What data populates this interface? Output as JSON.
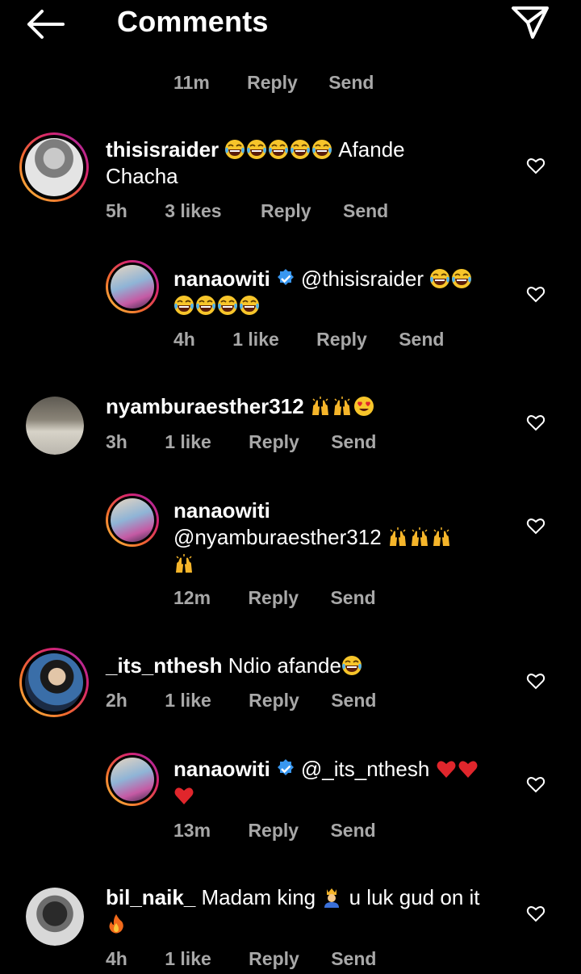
{
  "header": {
    "title": "Comments"
  },
  "top_meta": {
    "time": "11m",
    "reply": "Reply",
    "send": "Send"
  },
  "comments": [
    {
      "user": "thisisraider",
      "text_after": "Afande",
      "text_line2": "Chacha",
      "time": "5h",
      "likes": "3 likes",
      "reply": "Reply",
      "send": "Send",
      "emoji": [
        "laugh-cry",
        "laugh-cry",
        "laugh-cry",
        "laugh-cry",
        "laugh-cry"
      ]
    },
    {
      "user": "nanaowiti",
      "verified": true,
      "mention": "@thisisraider",
      "time": "4h",
      "likes": "1 like",
      "reply": "Reply",
      "send": "Send",
      "emoji": [
        "laugh-cry",
        "laugh-cry",
        "laugh-cry",
        "laugh-cry",
        "laugh-cry",
        "laugh-cry"
      ]
    },
    {
      "user": "nyamburaesther312",
      "time": "3h",
      "likes": "1 like",
      "reply": "Reply",
      "send": "Send",
      "emoji": [
        "raised-hands",
        "raised-hands",
        "heart-eyes"
      ]
    },
    {
      "user": "nanaowiti",
      "mention": "@nyamburaesther312",
      "time": "12m",
      "reply": "Reply",
      "send": "Send",
      "emoji": [
        "raised-hands",
        "raised-hands",
        "raised-hands",
        "raised-hands"
      ]
    },
    {
      "user": "_its_nthesh",
      "text_after": "Ndio afande",
      "time": "2h",
      "likes": "1 like",
      "reply": "Reply",
      "send": "Send",
      "emoji": [
        "laugh-cry"
      ]
    },
    {
      "user": "nanaowiti",
      "verified": true,
      "mention": "@_its_nthesh",
      "time": "13m",
      "reply": "Reply",
      "send": "Send",
      "emoji": [
        "red-heart",
        "red-heart",
        "red-heart"
      ]
    },
    {
      "user": "bil_naik_",
      "text_before": "Madam king",
      "text_after": "u luk gud on it",
      "time": "4h",
      "likes": "1 like",
      "reply": "Reply",
      "send": "Send",
      "emoji": [
        "prince",
        "fire"
      ]
    }
  ],
  "colors": {
    "background": "#000000",
    "meta_text": "#a8a8a8",
    "verified": "#3897f0",
    "heart_emoji": "#e0262c"
  }
}
